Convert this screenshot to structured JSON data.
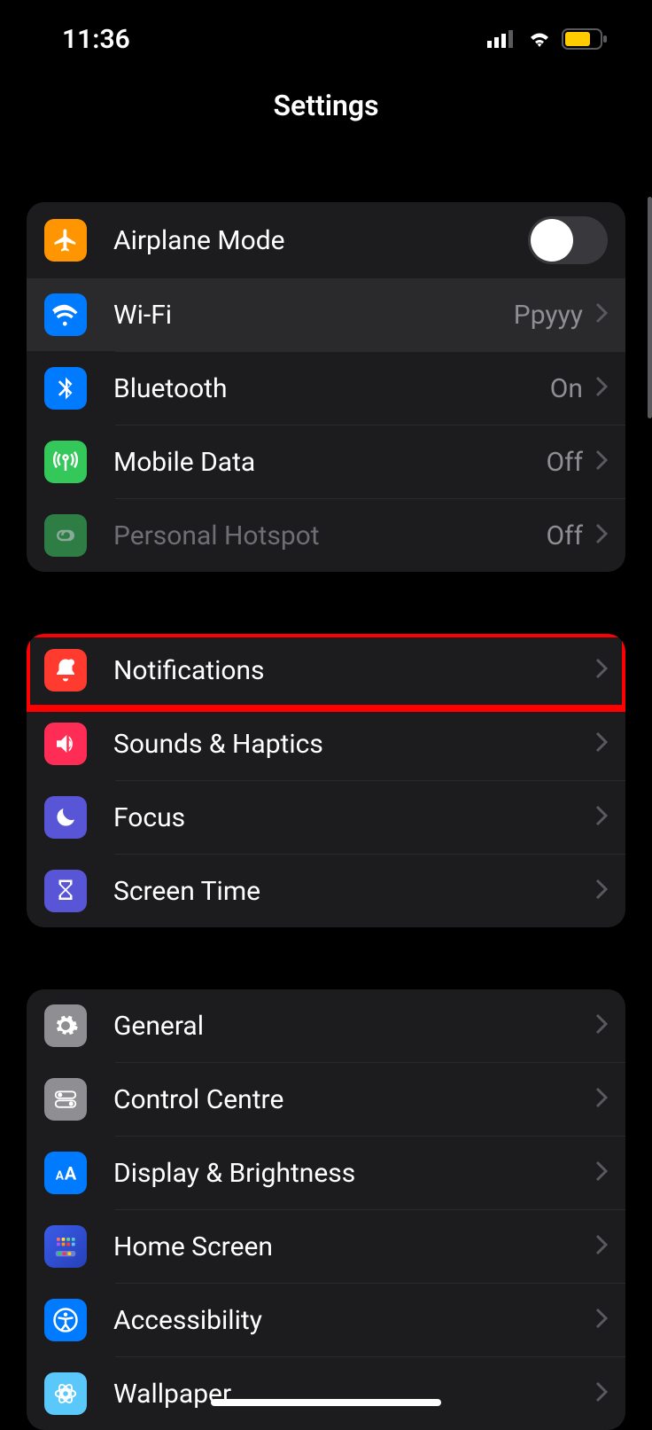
{
  "status": {
    "time": "11:36"
  },
  "header": {
    "title": "Settings"
  },
  "groups": [
    {
      "rows": [
        {
          "id": "airplane",
          "label": "Airplane Mode",
          "value": null,
          "toggle": true,
          "toggle_on": false,
          "icon": "airplane",
          "color": "orange",
          "disabled": false
        },
        {
          "id": "wifi",
          "label": "Wi-Fi",
          "value": "Ppyyy",
          "icon": "wifi",
          "color": "blue",
          "highlighted": true,
          "disabled": false
        },
        {
          "id": "bluetooth",
          "label": "Bluetooth",
          "value": "On",
          "icon": "bluetooth",
          "color": "blue",
          "disabled": false
        },
        {
          "id": "mobiledata",
          "label": "Mobile Data",
          "value": "Off",
          "icon": "antenna",
          "color": "green",
          "disabled": false
        },
        {
          "id": "hotspot",
          "label": "Personal Hotspot",
          "value": "Off",
          "icon": "hotspot",
          "color": "greendark",
          "disabled": true
        }
      ]
    },
    {
      "rows": [
        {
          "id": "notifications",
          "label": "Notifications",
          "icon": "bell",
          "color": "red",
          "redbox": true
        },
        {
          "id": "sounds",
          "label": "Sounds & Haptics",
          "icon": "speaker",
          "color": "pink"
        },
        {
          "id": "focus",
          "label": "Focus",
          "icon": "moon",
          "color": "indigo"
        },
        {
          "id": "screentime",
          "label": "Screen Time",
          "icon": "hourglass",
          "color": "indigo"
        }
      ]
    },
    {
      "rows": [
        {
          "id": "general",
          "label": "General",
          "icon": "gear",
          "color": "gray"
        },
        {
          "id": "controlcentre",
          "label": "Control Centre",
          "icon": "switches",
          "color": "gray"
        },
        {
          "id": "display",
          "label": "Display & Brightness",
          "icon": "aa",
          "color": "blue"
        },
        {
          "id": "homescreen",
          "label": "Home Screen",
          "icon": "grid",
          "color": "blue"
        },
        {
          "id": "accessibility",
          "label": "Accessibility",
          "icon": "person",
          "color": "blue"
        },
        {
          "id": "wallpaper",
          "label": "Wallpaper",
          "icon": "flower",
          "color": "lightblue"
        }
      ]
    }
  ]
}
